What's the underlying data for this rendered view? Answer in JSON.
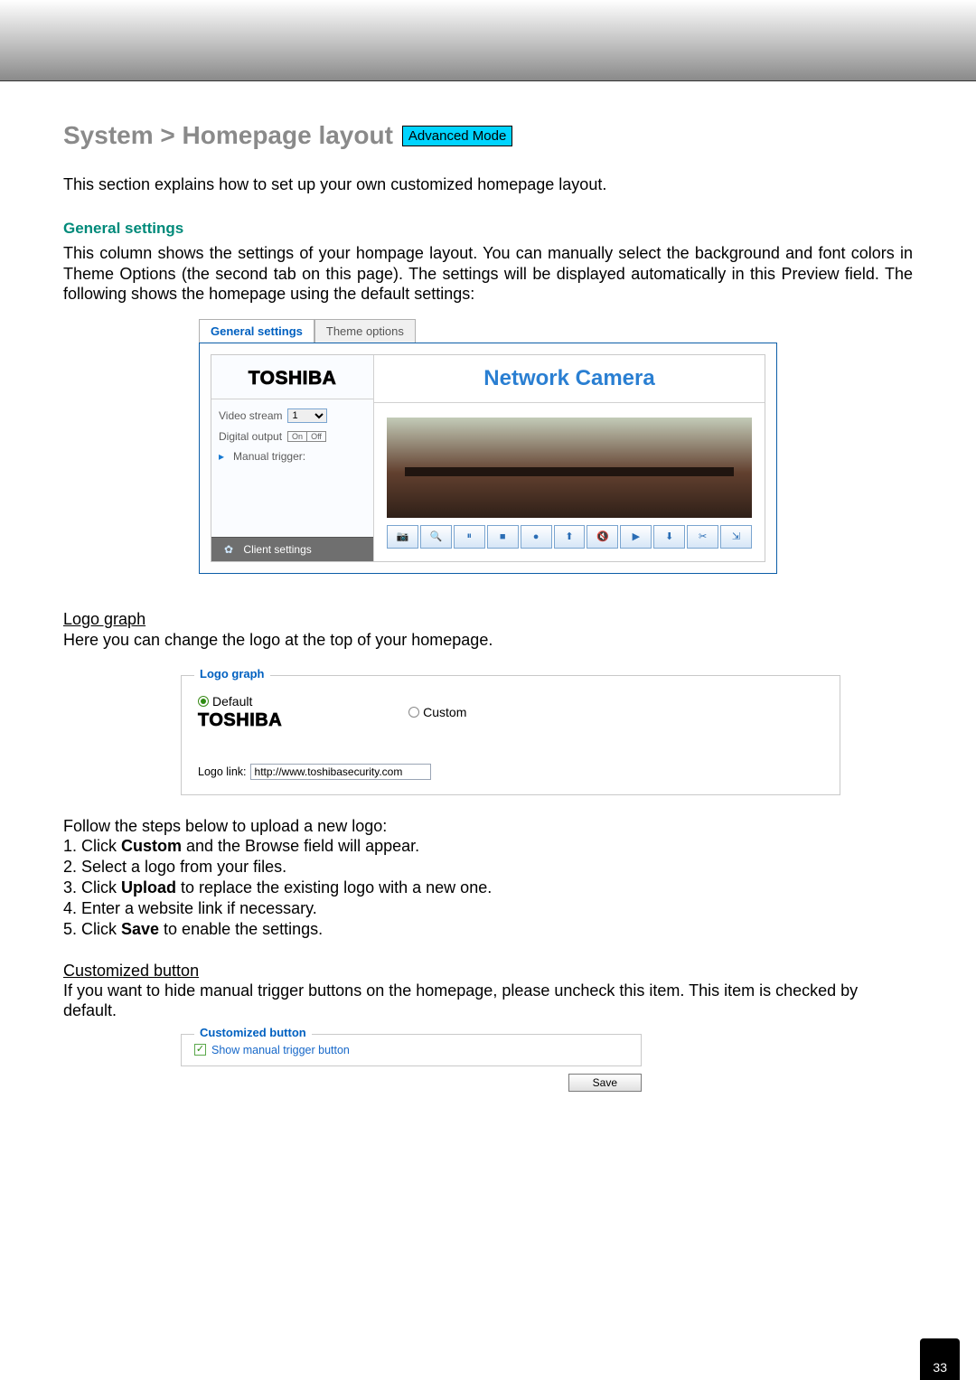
{
  "page_number": "33",
  "title": {
    "breadcrumb": "System > Homepage layout",
    "badge": "Advanced Mode"
  },
  "intro": "This section explains how to set up your own customized homepage layout.",
  "general": {
    "heading": "General settings",
    "body": "This column shows the settings of your hompage layout. You can manually select the background and font colors in Theme Options (the second tab on this page). The settings will be displayed automatically in this Preview field. The following shows the homepage using the default settings:"
  },
  "preview": {
    "tabs": {
      "general": "General settings",
      "theme": "Theme options"
    },
    "logo_text": "TOSHIBA",
    "camera_title": "Network Camera",
    "controls": {
      "video_stream_label": "Video stream",
      "video_stream_value": "1",
      "digital_output_label": "Digital output",
      "on": "On",
      "off": "Off",
      "manual_trigger": "Manual trigger:",
      "client_settings": "Client settings"
    },
    "toolbar_icons": [
      "📷",
      "🔍",
      "⏸",
      "■",
      "●",
      "⬆",
      "🔇",
      "▶",
      "⬇",
      "✂",
      "⇲"
    ]
  },
  "logo_graph": {
    "heading": "Logo graph",
    "desc": "Here you can change the logo at the top of your homepage.",
    "legend": "Logo graph",
    "option_default": "Default",
    "option_custom": "Custom",
    "brand": "TOSHIBA",
    "logo_link_label": "Logo link:",
    "logo_link_value": "http://www.toshibasecurity.com"
  },
  "upload_steps": {
    "lead": "Follow the steps below to upload a new logo:",
    "items": [
      {
        "pre": "Click ",
        "bold": "Custom",
        "post": " and the Browse field will appear."
      },
      {
        "pre": "Select a logo from your files.",
        "bold": "",
        "post": ""
      },
      {
        "pre": "Click ",
        "bold": "Upload",
        "post": " to replace the existing logo with a new one."
      },
      {
        "pre": "Enter a website link if necessary.",
        "bold": "",
        "post": ""
      },
      {
        "pre": "Click ",
        "bold": "Save",
        "post": " to enable the settings."
      }
    ]
  },
  "customized_button": {
    "heading": "Customized button",
    "body": "If you want to hide manual trigger buttons on the homepage, please uncheck this item. This item is checked by default.",
    "legend": "Customized button",
    "checkbox_label": "Show manual trigger button",
    "save": "Save"
  }
}
